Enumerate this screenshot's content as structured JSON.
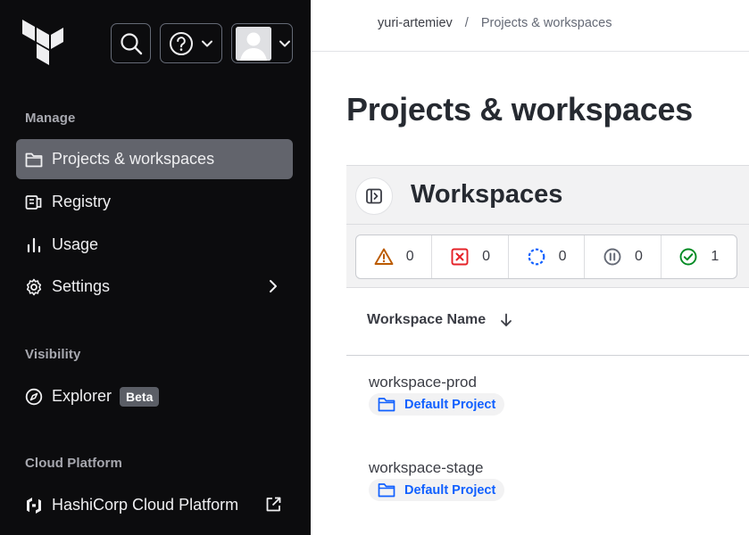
{
  "topbar": {
    "search_icon": "search-icon",
    "help_icon": "help-icon",
    "user_icon": "user-avatar"
  },
  "sidebar": {
    "sections": [
      {
        "title": "Manage"
      },
      {
        "title": "Visibility"
      },
      {
        "title": "Cloud Platform"
      }
    ],
    "items": [
      {
        "label": "Projects & workspaces",
        "icon": "folder-icon",
        "active": true
      },
      {
        "label": "Registry",
        "icon": "registry-icon"
      },
      {
        "label": "Usage",
        "icon": "bar-chart-icon"
      },
      {
        "label": "Settings",
        "icon": "gear-icon"
      },
      {
        "label": "Explorer",
        "icon": "compass-icon",
        "badge": "Beta"
      },
      {
        "label": "HashiCorp Cloud Platform",
        "icon": "hashicorp-icon"
      }
    ]
  },
  "breadcrumb": {
    "org": "yuri-artemiev",
    "separator": "/",
    "current": "Projects & workspaces"
  },
  "main": {
    "page_title": "Projects & workspaces",
    "workspaces_title": "Workspaces",
    "status_counts": [
      {
        "icon": "warning-icon",
        "count": "0",
        "color": "#bb5a00"
      },
      {
        "icon": "error-icon",
        "count": "0",
        "color": "#e52228"
      },
      {
        "icon": "running-icon",
        "count": "0",
        "color": "#1060ff"
      },
      {
        "icon": "paused-icon",
        "count": "0",
        "color": "#656a76"
      },
      {
        "icon": "success-icon",
        "count": "1",
        "color": "#008a22"
      }
    ],
    "column_header": "Workspace Name",
    "workspaces": [
      {
        "name": "workspace-prod",
        "project": "Default Project"
      },
      {
        "name": "workspace-stage",
        "project": "Default Project"
      }
    ]
  },
  "colors": {
    "sidebar_bg": "#0c0c0e",
    "active_item_bg": "#62646c",
    "link_blue": "#1060ff"
  }
}
